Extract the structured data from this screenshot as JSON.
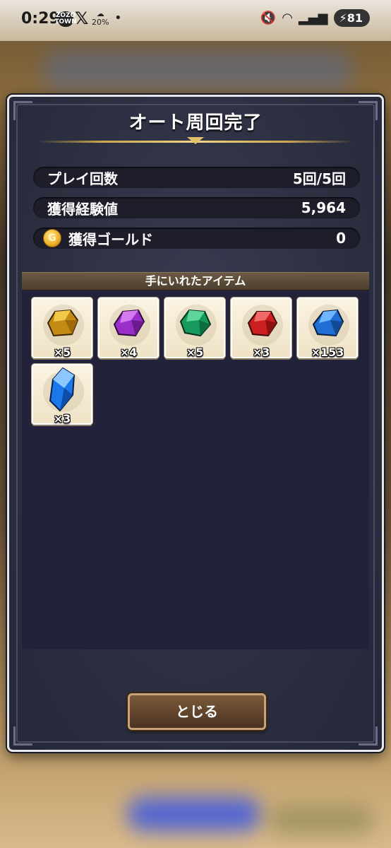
{
  "status_bar": {
    "time": "0:29",
    "zozo_badge": "ZOZO TOWN",
    "x_logo": "𝕏",
    "weather": "20%",
    "battery": "81"
  },
  "dialog": {
    "title": "オート周回完了",
    "stats": [
      {
        "label": "プレイ回数",
        "value": "5回/5回"
      },
      {
        "label": "獲得経験値",
        "value": "5,964"
      },
      {
        "label": "獲得ゴールド",
        "value": "0",
        "icon": "gold-coin-icon"
      }
    ],
    "items_header": "手にいれたアイテム",
    "items": [
      {
        "name": "yellow-gem-icon",
        "color": "#d4a12a",
        "qty": "×5"
      },
      {
        "name": "purple-gem-icon",
        "color": "#a43ad6",
        "qty": "×4"
      },
      {
        "name": "green-gem-icon",
        "color": "#1fa36a",
        "qty": "×5"
      },
      {
        "name": "red-gem-icon",
        "color": "#d92a2a",
        "qty": "×3"
      },
      {
        "name": "blue-gem-icon",
        "color": "#2a7ee0",
        "qty": "×153"
      },
      {
        "name": "blue-crystal-icon",
        "color": "#2a8ef5",
        "qty": "×3"
      }
    ],
    "close_label": "とじる"
  }
}
